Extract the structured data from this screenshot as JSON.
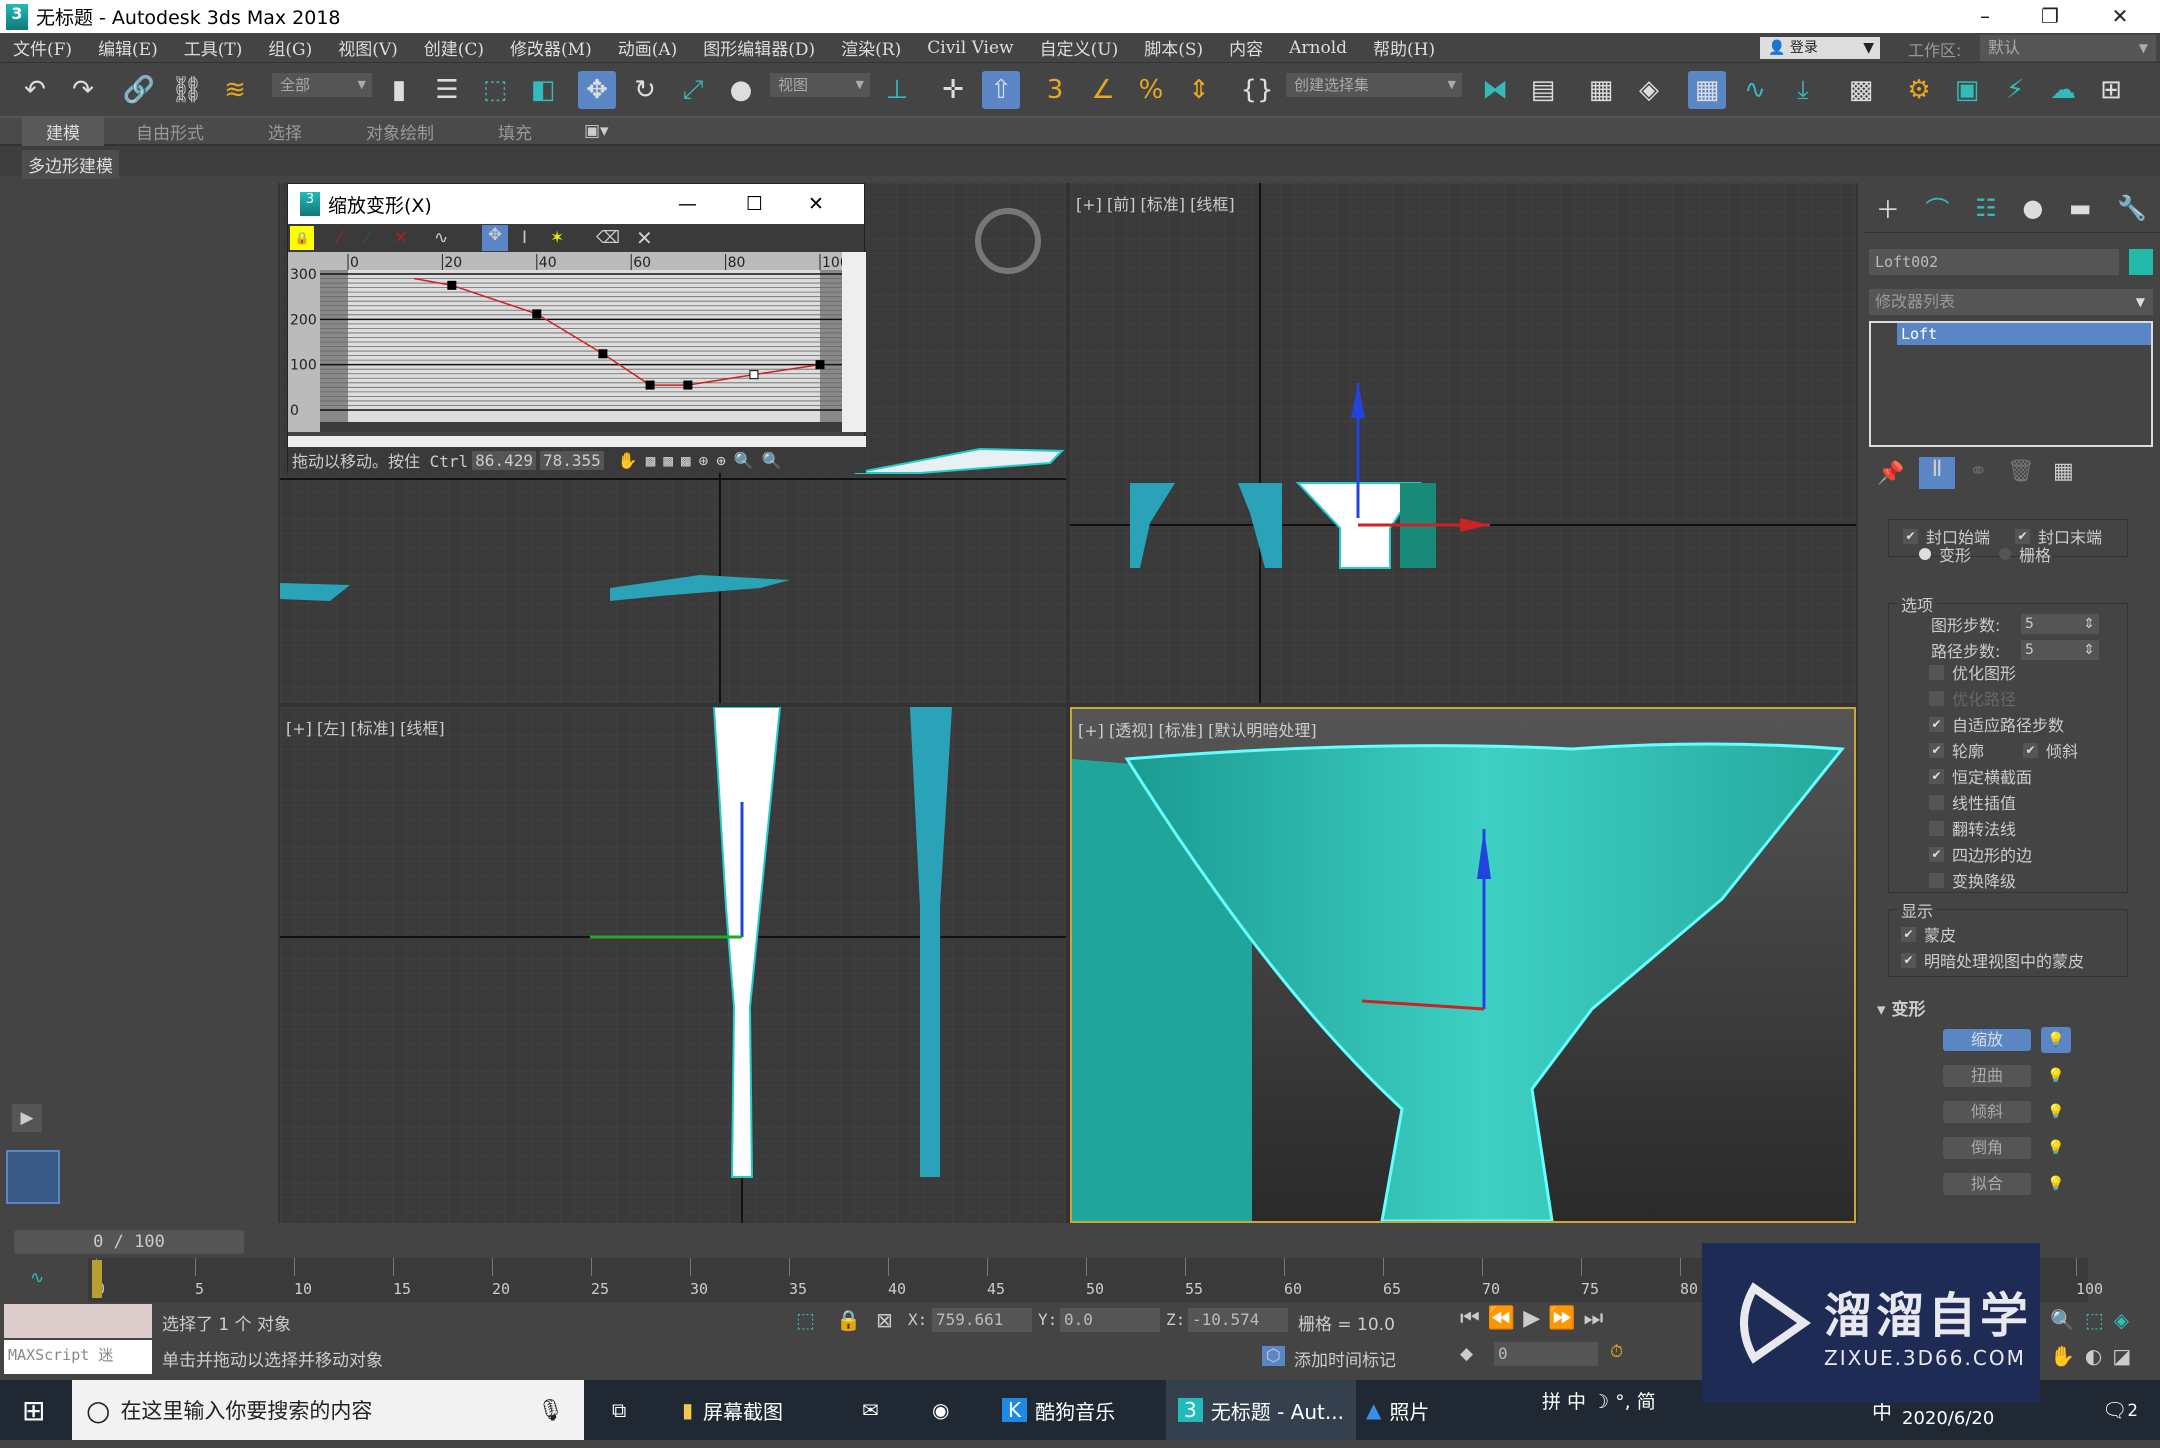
{
  "window": {
    "title": "无标题 - Autodesk 3ds Max 2018",
    "app_icon": "3"
  },
  "menu": [
    "文件(F)",
    "编辑(E)",
    "工具(T)",
    "组(G)",
    "视图(V)",
    "创建(C)",
    "修改器(M)",
    "动画(A)",
    "图形编辑器(D)",
    "渲染(R)",
    "Civil View",
    "自定义(U)",
    "脚本(S)",
    "内容",
    "Arnold",
    "帮助(H)"
  ],
  "account": {
    "login": "登录",
    "workspace_label": "工作区:",
    "workspace_value": "默认"
  },
  "toolbar": {
    "selection_filter": "全部",
    "reference_coord": "视图",
    "named_selection": "创建选择集"
  },
  "ribbon": {
    "tabs": [
      "建模",
      "自由形式",
      "选择",
      "对象绘制",
      "填充"
    ],
    "active": "建模",
    "sub_label": "多边形建模"
  },
  "viewports": {
    "top": {
      "label": ""
    },
    "front": {
      "label": "[+] [前] [标准] [线框]"
    },
    "left": {
      "label": "[+] [左] [标准] [线框]"
    },
    "perspective": {
      "label": "[+] [透视] [标准] [默认明暗处理]"
    }
  },
  "scale_dialog": {
    "title": "缩放变形(X)",
    "x_ticks": [
      "0",
      "20",
      "40",
      "60",
      "80",
      "100"
    ],
    "y_ticks": [
      "300",
      "200",
      "100",
      "0"
    ],
    "curve_points": [
      [
        14,
        290
      ],
      [
        22,
        275
      ],
      [
        40,
        212
      ],
      [
        54,
        124
      ],
      [
        64,
        55
      ],
      [
        72,
        55
      ],
      [
        86,
        78
      ],
      [
        100,
        100
      ]
    ],
    "status": "拖动以移动。按住 Ctrl",
    "x_value": "86.429",
    "y_value": "78.355"
  },
  "command_panel": {
    "object_name": "Loft002",
    "object_color": "#22bbaa",
    "modifier_list": "修改器列表",
    "stack": [
      "Loft"
    ],
    "cap": {
      "cap_start": "封口始端",
      "cap_end": "封口末端",
      "morph": "变形",
      "grid": "栅格"
    },
    "options": {
      "title": "选项",
      "shape_steps_label": "图形步数:",
      "shape_steps": "5",
      "path_steps_label": "路径步数:",
      "path_steps": "5",
      "items": [
        {
          "label": "优化图形",
          "checked": false
        },
        {
          "label": "优化路径",
          "checked": false,
          "disabled": true
        },
        {
          "label": "自适应路径步数",
          "checked": true
        },
        {
          "label": "轮廓",
          "checked": true
        },
        {
          "label": "倾斜",
          "checked": true
        },
        {
          "label": "恒定横截面",
          "checked": true
        },
        {
          "label": "线性插值",
          "checked": false
        },
        {
          "label": "翻转法线",
          "checked": false
        },
        {
          "label": "四边形的边",
          "checked": true
        },
        {
          "label": "变换降级",
          "checked": false
        }
      ]
    },
    "display": {
      "title": "显示",
      "skin": "蒙皮",
      "skin_shaded": "明暗处理视图中的蒙皮"
    },
    "deformations": {
      "title": "变形",
      "buttons": [
        "缩放",
        "扭曲",
        "倾斜",
        "倒角",
        "拟合"
      ],
      "active": "缩放"
    }
  },
  "timeline": {
    "frame": "0 / 100",
    "ticks": [
      "0",
      "5",
      "10",
      "15",
      "20",
      "25",
      "30",
      "35",
      "40",
      "45",
      "50",
      "55",
      "60",
      "65",
      "70",
      "75",
      "80",
      "85",
      "90",
      "95",
      "100"
    ]
  },
  "status": {
    "selection": "选择了 1 个 对象",
    "prompt": "单击并拖动以选择并移动对象",
    "maxscript": "MAXScript 迷",
    "x_label": "X:",
    "x": "759.661",
    "y_label": "Y:",
    "y": "0.0",
    "z_label": "Z:",
    "z": "-10.574",
    "grid": "栅格 = 10.0",
    "add_time_tag": "添加时间标记",
    "current_frame": "0"
  },
  "taskbar": {
    "search": "在这里输入你要搜索的内容",
    "items": [
      "屏幕截图",
      "酷狗音乐",
      "无标题 - Aut...",
      "照片"
    ],
    "ime": "拼 中 ☽ °, 简",
    "lang": "中",
    "date": "2020/6/20",
    "notifications": "2"
  },
  "watermark": {
    "brand": "溜溜自学",
    "url": "ZIXUE.3D66.COM"
  }
}
